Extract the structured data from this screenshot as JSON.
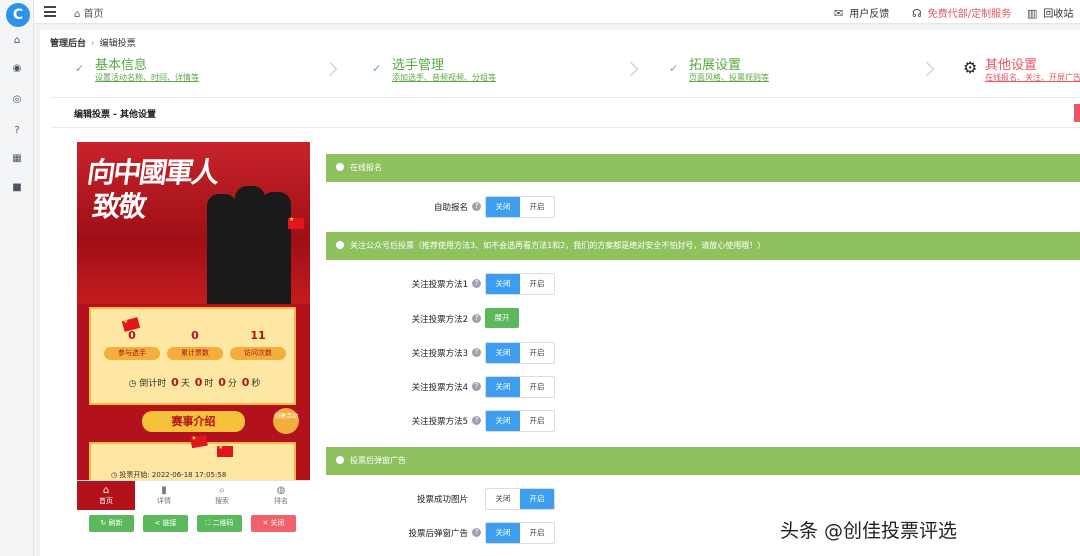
{
  "app": {
    "logo": "C",
    "home": "首页"
  },
  "sidebar": {
    "icons": [
      "home-icon",
      "box-icon",
      "user-icon",
      "help-icon",
      "grid-icon",
      "video-icon"
    ]
  },
  "topbar": {
    "feedback": "用户反馈",
    "custom": "免费代部/定制服务",
    "recycle": "回收站",
    "custom_color": "#e8565f"
  },
  "breadcrumb": {
    "root": "管理后台",
    "current": "编辑投票"
  },
  "steps": [
    {
      "title": "基本信息",
      "sub": "设置活动名称、时间、详情等"
    },
    {
      "title": "选手管理",
      "sub": "添加选手、音频视频、分组等"
    },
    {
      "title": "拓展设置",
      "sub": "页面风格、投票规则等"
    },
    {
      "title": "其他设置",
      "sub": "在线报名、关注、开屏广告..."
    }
  ],
  "section_title": "编辑投票 - 其他设置",
  "preview": {
    "banner": {
      "line1": "向中國軍人",
      "line2": "致敬"
    },
    "stats": [
      {
        "value": "0",
        "label": "参与选手"
      },
      {
        "value": "0",
        "label": "累计票数"
      },
      {
        "value": "11",
        "label": "访问次数"
      }
    ],
    "countdown": {
      "prefix": "倒计时",
      "d": "0",
      "d_unit": "天",
      "h": "0",
      "h_unit": "时",
      "m": "0",
      "m_unit": "分",
      "s": "0",
      "s_unit": "秒"
    },
    "intro": "赛事介绍",
    "create": "创建活动",
    "start": "投票开始: 2022-06-18 17:05:58",
    "nav": [
      "首页",
      "详情",
      "搜索",
      "排名"
    ],
    "actions": [
      {
        "label": "刷新",
        "color": "#5cb85c"
      },
      {
        "label": "链接",
        "color": "#5cb85c"
      },
      {
        "label": "二维码",
        "color": "#5cb85c"
      },
      {
        "label": "关闭",
        "color": "#f0616b"
      }
    ]
  },
  "settings": {
    "group1": "在线报名",
    "group2": "关注公众号后投票（推荐使用方法3、如不会选再看方法1和2，我们的方案都是绝对安全不怕封号，请放心使用哦！）",
    "group3": "投票后弹窗广告",
    "off": "关闭",
    "on": "开启",
    "expand": "展开",
    "rows": [
      {
        "label": "自助报名",
        "state": "off"
      },
      {
        "label": "关注投票方法1",
        "state": "off"
      },
      {
        "label": "关注投票方法2",
        "state": "expand"
      },
      {
        "label": "关注投票方法3",
        "state": "off"
      },
      {
        "label": "关注投票方法4",
        "state": "off"
      },
      {
        "label": "关注投票方法5",
        "state": "off"
      },
      {
        "label": "投票成功图片",
        "state": "on"
      },
      {
        "label": "投票后弹窗广告",
        "state": "off"
      }
    ],
    "group_color": "#8fc25f",
    "accent": "#3d9ef0"
  },
  "watermark": "头条 @创佳投票评选"
}
